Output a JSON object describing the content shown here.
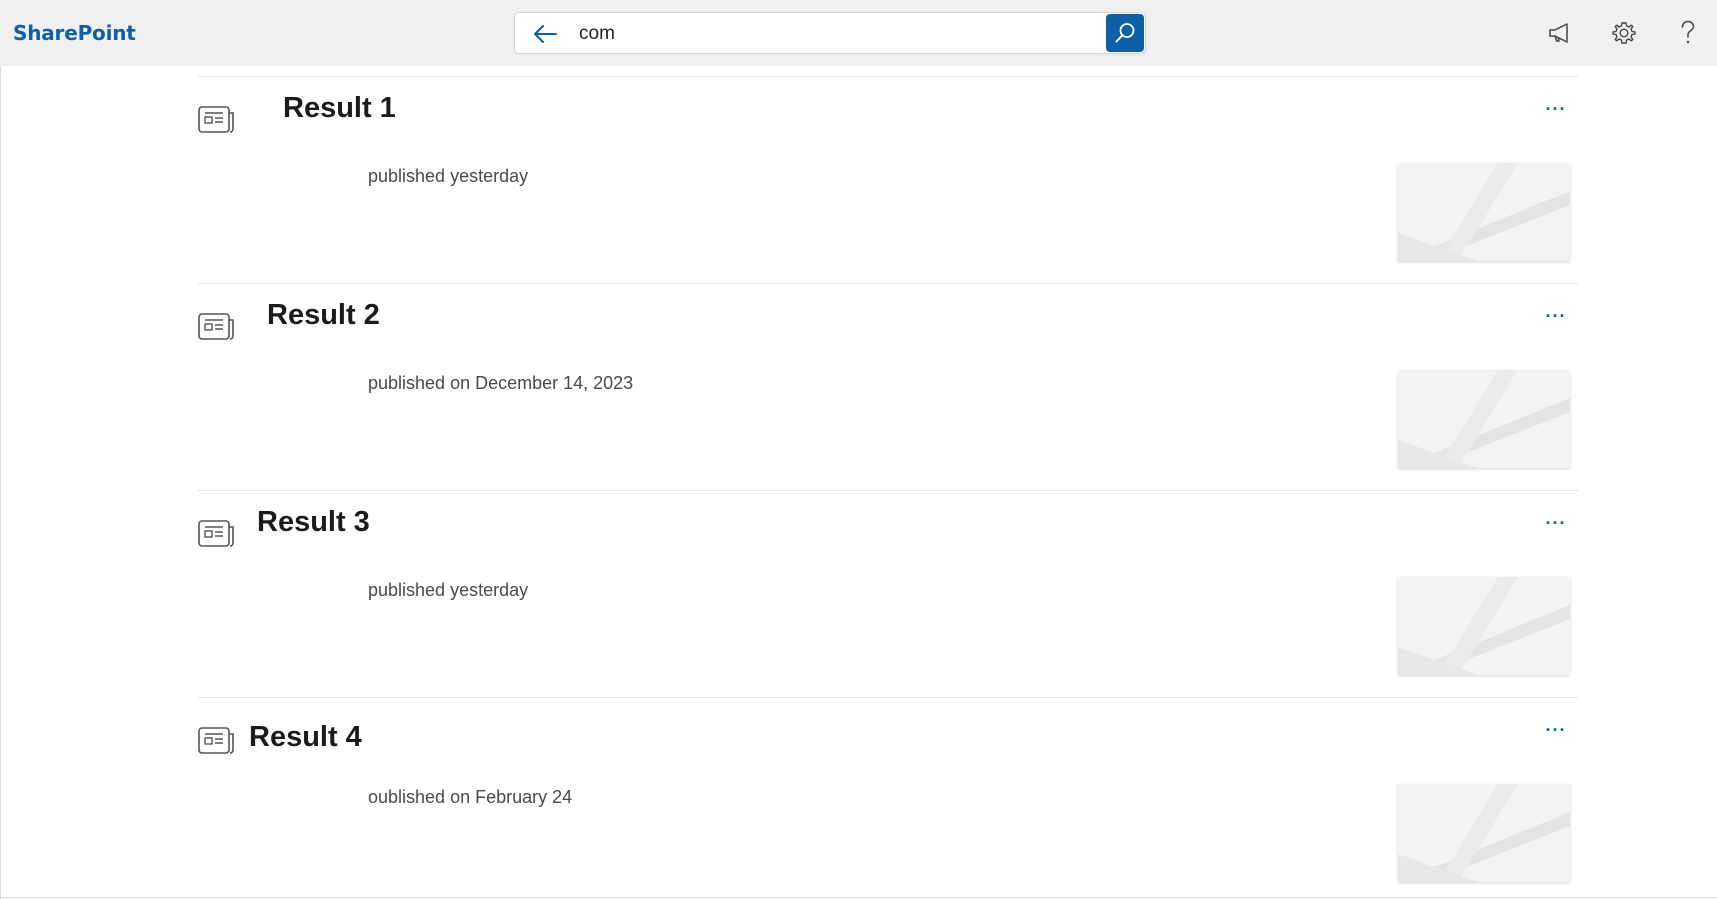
{
  "app": {
    "brand": "SharePoint",
    "accent_color": "#0f5ea8"
  },
  "search": {
    "value": "com",
    "back_icon": "arrow-left-icon",
    "submit_icon": "search-icon"
  },
  "header_icons": {
    "megaphone": "megaphone-icon",
    "settings": "gear-icon",
    "help": "question-mark-icon"
  },
  "results": [
    {
      "title": "Result 1",
      "meta": "published yesterday",
      "more": "···"
    },
    {
      "title": "Result 2",
      "meta": "published on December 14, 2023",
      "more": "···"
    },
    {
      "title": "Result 3",
      "meta": "published yesterday",
      "more": "···"
    },
    {
      "title": "Result 4",
      "meta": "oublished on February 24",
      "more": "···"
    }
  ]
}
